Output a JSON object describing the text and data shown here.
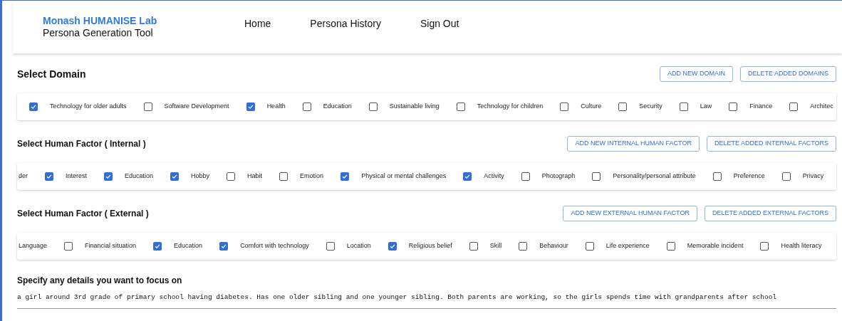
{
  "header": {
    "lab_name": "Monash HUMANISE Lab",
    "tool_name": "Persona Generation Tool",
    "nav": [
      "Home",
      "Persona History",
      "Sign Out"
    ]
  },
  "sections": [
    {
      "title": "Select Domain",
      "buttons": [
        "ADD NEW DOMAIN",
        "DELETE ADDED DOMAINS"
      ],
      "items": [
        {
          "label": "Technology for older adults",
          "checked": true
        },
        {
          "label": "Software Development",
          "checked": false
        },
        {
          "label": "Health",
          "checked": true
        },
        {
          "label": "Education",
          "checked": false
        },
        {
          "label": "Sustainable living",
          "checked": false
        },
        {
          "label": "Technology for children",
          "checked": false
        },
        {
          "label": "Culture",
          "checked": false
        },
        {
          "label": "Security",
          "checked": false
        },
        {
          "label": "Law",
          "checked": false
        },
        {
          "label": "Finance",
          "checked": false
        },
        {
          "label": "Architec",
          "checked": false
        }
      ]
    },
    {
      "title": "Select Human Factor ( Internal )",
      "buttons": [
        "ADD NEW INTERNAL HUMAN FACTOR",
        "DELETE ADDED INTERNAL FACTORS"
      ],
      "lead_label": "der",
      "items": [
        {
          "label": "Interest",
          "checked": true
        },
        {
          "label": "Education",
          "checked": true
        },
        {
          "label": "Hobby",
          "checked": true
        },
        {
          "label": "Habit",
          "checked": false
        },
        {
          "label": "Emotion",
          "checked": false
        },
        {
          "label": "Physical or mental challenges",
          "checked": true
        },
        {
          "label": "Activity",
          "checked": true
        },
        {
          "label": "Photograph",
          "checked": false
        },
        {
          "label": "Personality/personal attribute",
          "checked": false
        },
        {
          "label": "Preference",
          "checked": false
        },
        {
          "label": "Privacy",
          "checked": false
        }
      ]
    },
    {
      "title": "Select Human Factor ( External )",
      "buttons": [
        "ADD NEW EXTERNAL HUMAN FACTOR",
        "DELETE ADDED EXTERNAL FACTORS"
      ],
      "lead_label": "Language",
      "items": [
        {
          "label": "Financial situation",
          "checked": false
        },
        {
          "label": "Education",
          "checked": true
        },
        {
          "label": "Comfort with technology",
          "checked": true
        },
        {
          "label": "Location",
          "checked": false
        },
        {
          "label": "Religious belief",
          "checked": true
        },
        {
          "label": "Skill",
          "checked": false
        },
        {
          "label": "Behaviour",
          "checked": false
        },
        {
          "label": "Life experience",
          "checked": false
        },
        {
          "label": "Memorable incident",
          "checked": false
        },
        {
          "label": "Health literacy",
          "checked": false
        }
      ]
    }
  ],
  "details": {
    "title": "Specify any details you want to focus on",
    "value": "a girl around 3rd grade of primary school having diabetes. Has one older sibling and one younger sibling. Both parents are working, so the girls spends time with grandparents after school"
  }
}
